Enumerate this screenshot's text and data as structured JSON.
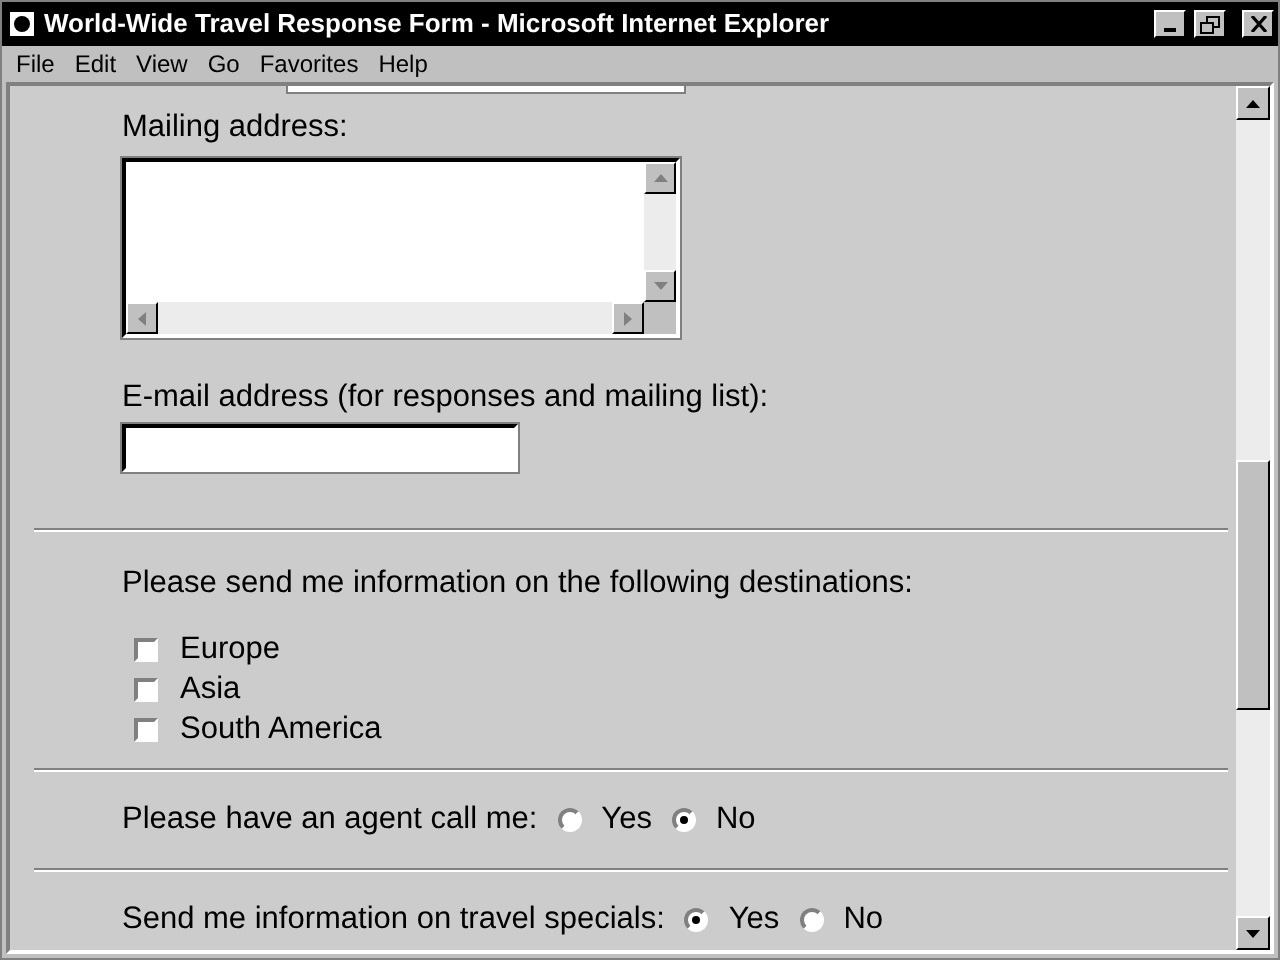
{
  "window": {
    "title": "World-Wide Travel Response Form - Microsoft Internet Explorer"
  },
  "menu": [
    "File",
    "Edit",
    "View",
    "Go",
    "Favorites",
    "Help"
  ],
  "mailing_address": {
    "label": "Mailing address:"
  },
  "email": {
    "label": "E-mail address (for responses and mailing list):"
  },
  "destinations": {
    "prompt": "Please send me information on the following destinations:",
    "options": [
      {
        "label": "Europe",
        "checked": false
      },
      {
        "label": "Asia",
        "checked": false
      },
      {
        "label": "South America",
        "checked": false
      }
    ]
  },
  "agent_call": {
    "prompt": "Please have an agent call me:",
    "options": [
      {
        "label": "Yes",
        "selected": false
      },
      {
        "label": "No",
        "selected": true
      }
    ]
  },
  "specials": {
    "prompt": "Send me information on travel specials:",
    "options": [
      {
        "label": "Yes",
        "selected": true
      },
      {
        "label": "No",
        "selected": false
      }
    ]
  }
}
